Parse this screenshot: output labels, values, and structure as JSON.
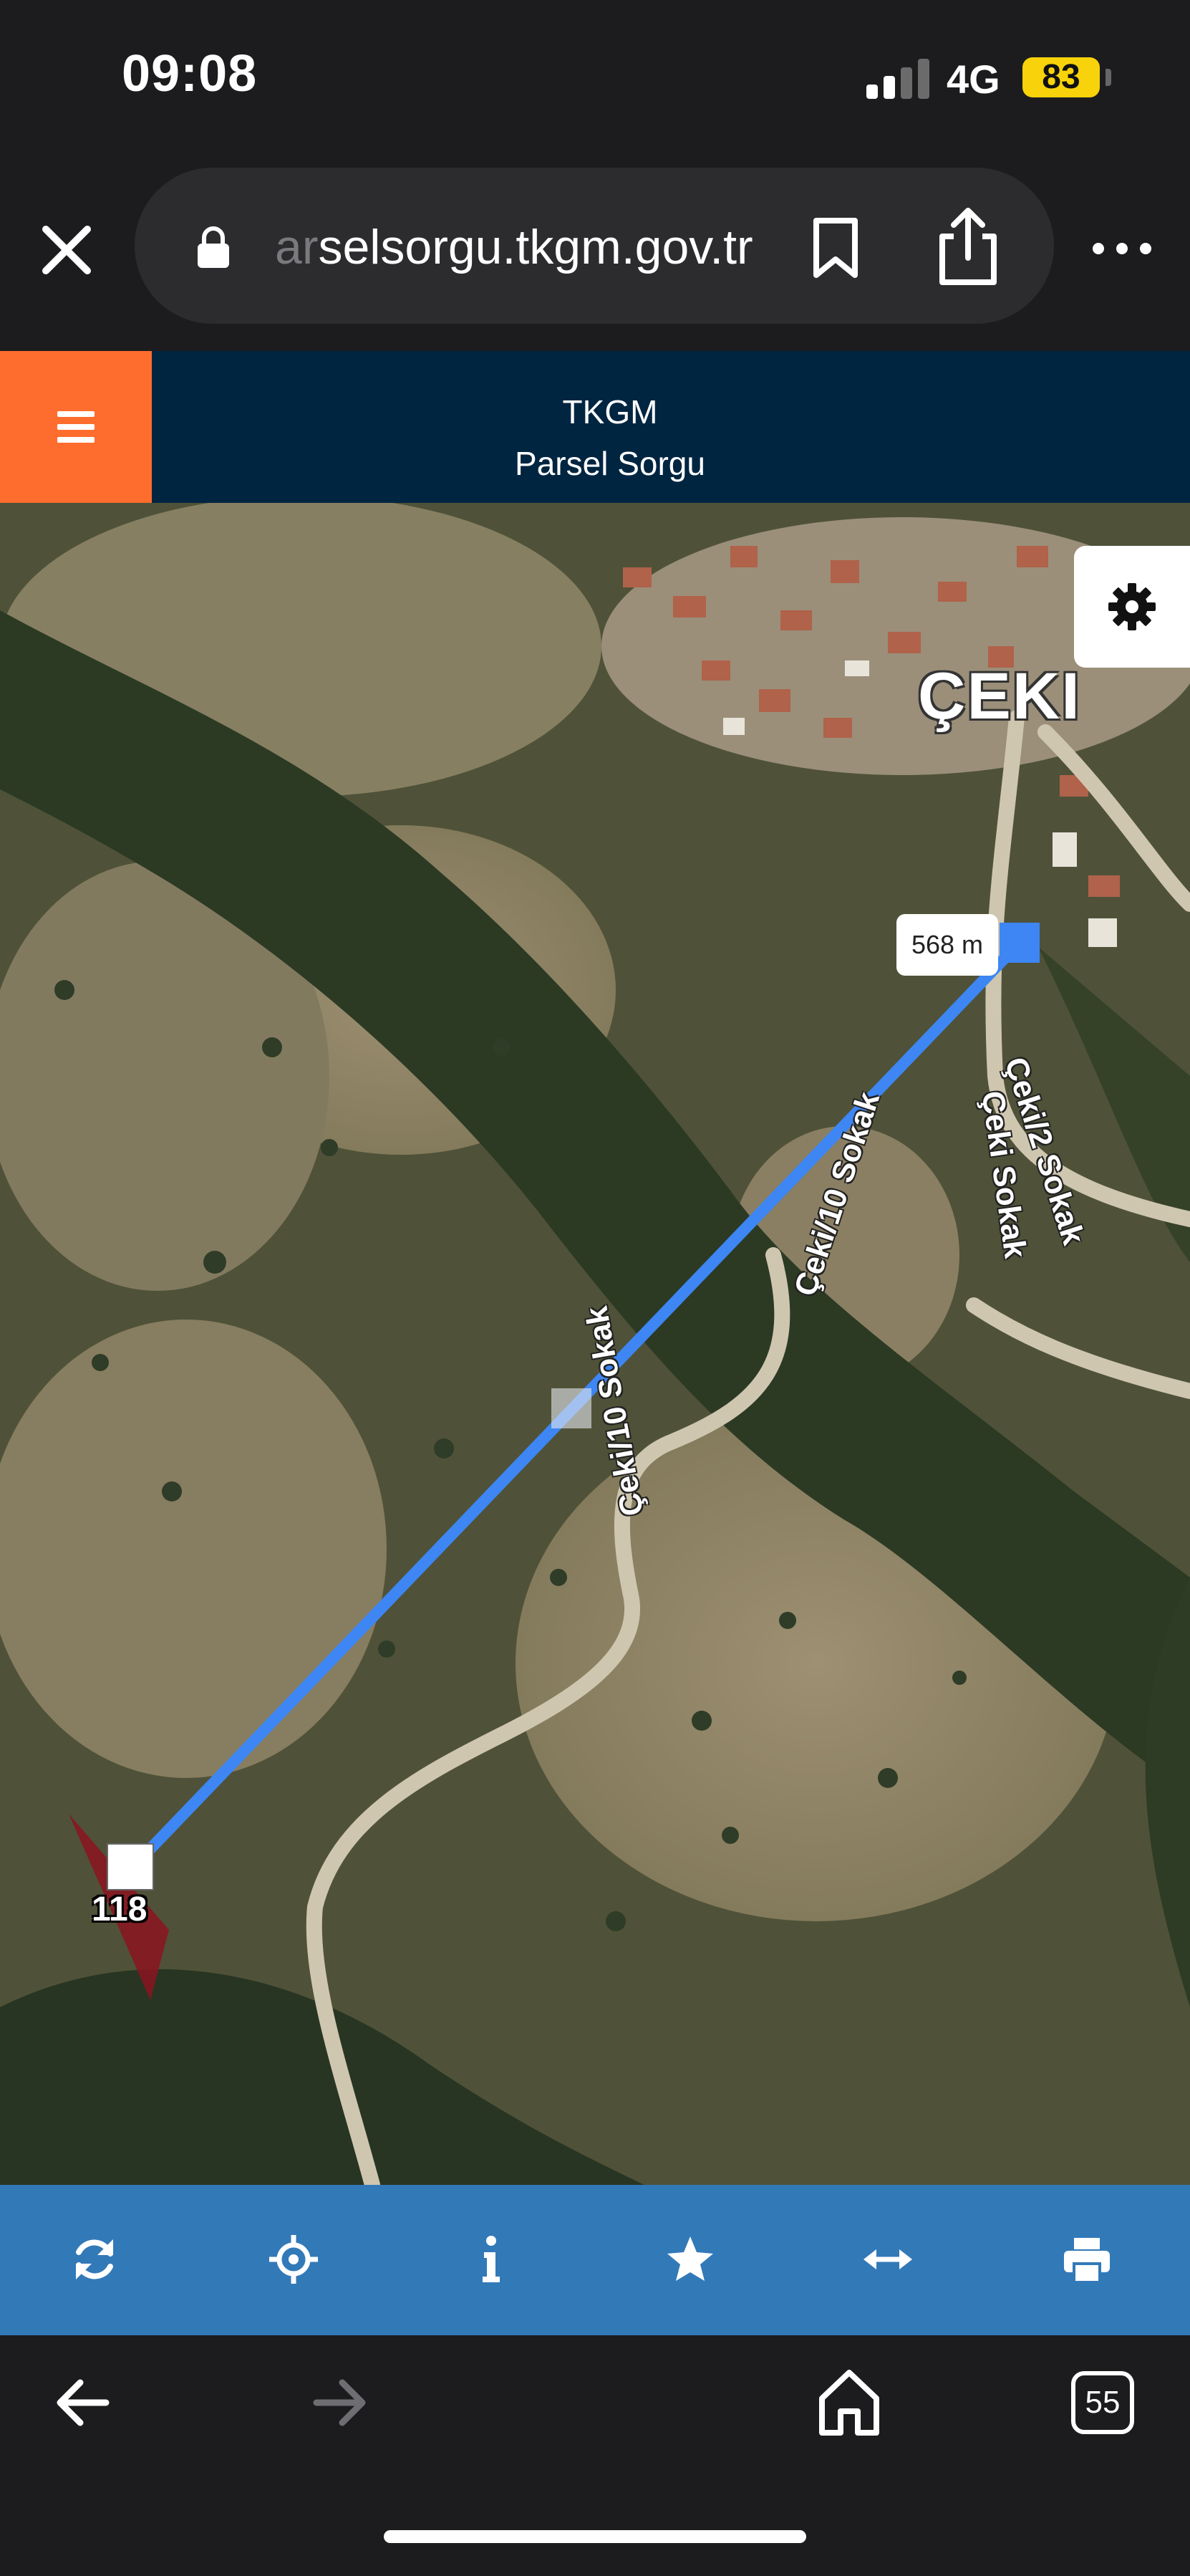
{
  "status_bar": {
    "time": "09:08",
    "network": "4G",
    "battery": "83",
    "colors": {
      "battery": "#f8d20b"
    }
  },
  "browser": {
    "url_faded": "ar",
    "url": "selsorgu.tkgm.gov.tr",
    "icons": [
      "close-icon",
      "lock-icon",
      "bookmark-icon",
      "share-icon",
      "more-icon"
    ]
  },
  "app_header": {
    "title": "TKGM",
    "subtitle": "Parsel Sorgu",
    "colors": {
      "header": "#002541",
      "menu": "#ff6d2e"
    }
  },
  "map": {
    "measurement": "568 m",
    "parcel_number": "118",
    "village_label": "ÇEKI",
    "streets": [
      "Çeki/2 Sokak",
      "Çeki Sokak",
      "Çeki/10 Sokak",
      "Çeki/10 Sokak"
    ],
    "colors": {
      "measure_line": "#3d86f3",
      "parcel": "#8b1420"
    }
  },
  "toolbar": {
    "icons": [
      "refresh-icon",
      "locate-icon",
      "info-icon",
      "star-icon",
      "measure-icon",
      "print-icon"
    ],
    "colors": {
      "background": "#3279b8"
    }
  },
  "browser_nav": {
    "tab_count": "55",
    "icons": [
      "back-icon",
      "forward-icon",
      "home-icon",
      "tabs-icon"
    ]
  }
}
